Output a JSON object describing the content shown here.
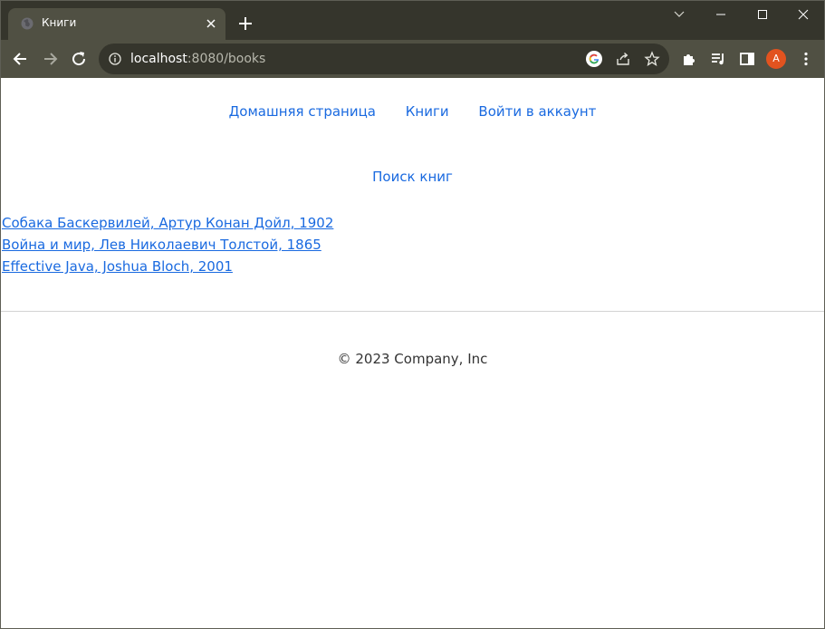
{
  "browser": {
    "tab": {
      "title": "Книги"
    },
    "address_bar": {
      "host": "localhost",
      "rest": ":8080/books"
    },
    "profile_initial": "A",
    "colors": {
      "frame": "#35352c",
      "toolbar": "#505043",
      "avatar": "#e2531f"
    }
  },
  "page": {
    "nav": {
      "home": "Домашняя страница",
      "books": "Книги",
      "login": "Войти в аккаунт"
    },
    "search_link": "Поиск книг",
    "books": [
      "Собака Баскервилей, Артур Конан Дойл, 1902",
      "Война и мир, Лев Николаевич Толстой, 1865",
      "Effective Java, Joshua Bloch, 2001"
    ],
    "footer": "© 2023 Company, Inc",
    "link_color": "#1a6ae0"
  }
}
